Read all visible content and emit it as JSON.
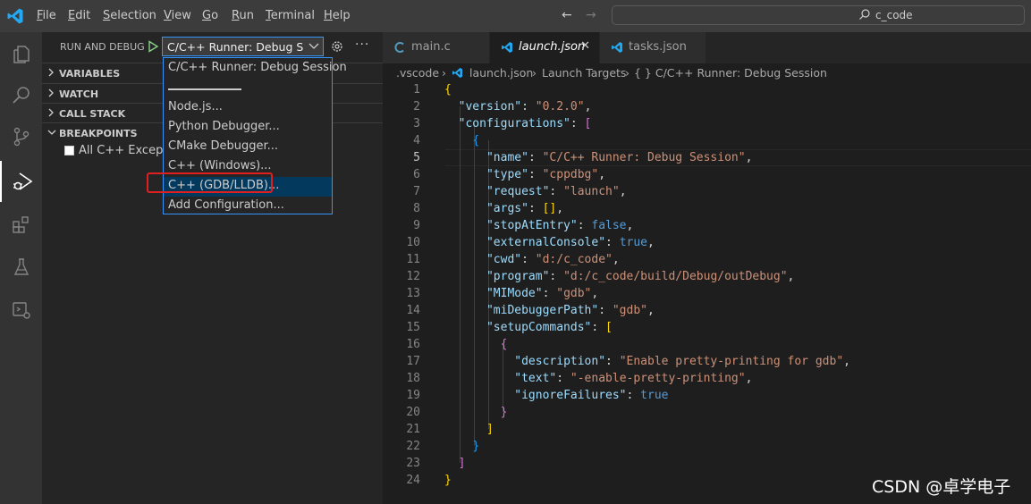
{
  "menu": [
    "File",
    "Edit",
    "Selection",
    "View",
    "Go",
    "Run",
    "Terminal",
    "Help"
  ],
  "search": {
    "text": "c_code"
  },
  "sidebar": {
    "title": "RUN AND DEBUG",
    "selected_config": "C/C++ Runner: Debug Session",
    "sections": [
      "VARIABLES",
      "WATCH",
      "CALL STACK",
      "BREAKPOINTS"
    ],
    "breakpoint_item": "All C++ Exceptions"
  },
  "dropdown": {
    "items": [
      "C/C++ Runner: Debug Session",
      "Node.js...",
      "Python Debugger...",
      "CMake Debugger...",
      "C++ (Windows)...",
      "C++ (GDB/LLDB)...",
      "Add Configuration..."
    ],
    "selected_index": 5
  },
  "tabs": [
    {
      "label": "main.c",
      "icon": "c-file-icon"
    },
    {
      "label": "launch.json",
      "icon": "vscode-file-icon",
      "active": true
    },
    {
      "label": "tasks.json",
      "icon": "vscode-file-icon"
    }
  ],
  "breadcrumb": [
    ".vscode",
    "launch.json",
    "Launch Targets",
    "{ } C/C++ Runner: Debug Session"
  ],
  "editor": {
    "current_line": 5,
    "line_numbers": [
      "1",
      "2",
      "3",
      "4",
      "5",
      "6",
      "7",
      "8",
      "9",
      "10",
      "11",
      "12",
      "13",
      "14",
      "15",
      "16",
      "17",
      "18",
      "19",
      "20",
      "21",
      "22",
      "23",
      "24"
    ]
  },
  "watermark": "CSDN @卓学电子",
  "colors": {
    "accent": "#3794ff",
    "highlight_box": "#e02020",
    "selection": "#04395e"
  }
}
